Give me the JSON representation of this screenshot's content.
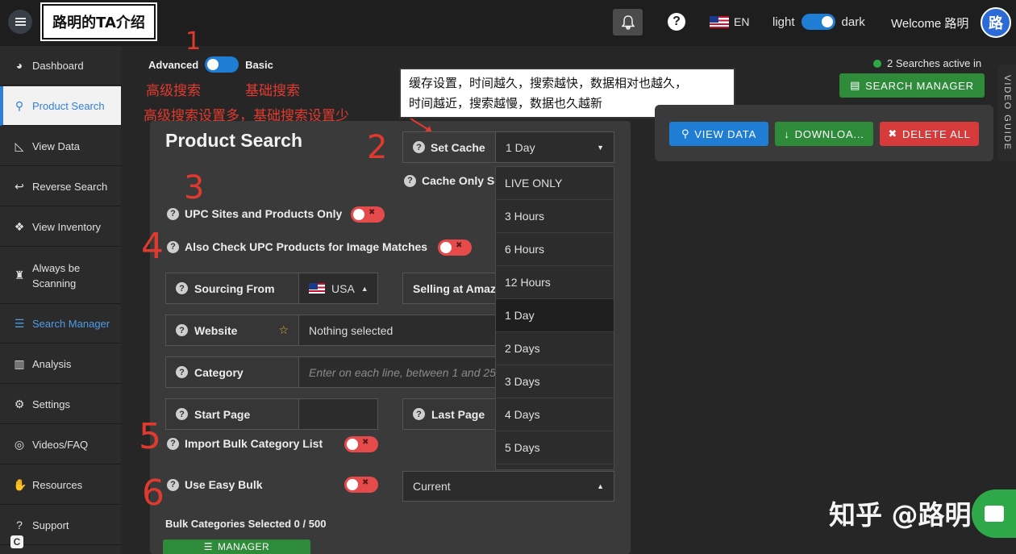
{
  "header": {
    "brand": "路明的TA介绍",
    "lang": "EN",
    "theme_light": "light",
    "theme_dark": "dark",
    "welcome": "Welcome 路明",
    "avatar_text": "路"
  },
  "sidebar": {
    "items": [
      {
        "label": "Dashboard",
        "icon": "pie-chart-icon"
      },
      {
        "label": "Product Search",
        "icon": "search-icon"
      },
      {
        "label": "View Data",
        "icon": "area-chart-icon"
      },
      {
        "label": "Reverse Search",
        "icon": "reply-icon"
      },
      {
        "label": "View Inventory",
        "icon": "cubes-icon"
      },
      {
        "label": "Always be Scanning",
        "icon": "trophy-icon"
      },
      {
        "label": "Search Manager",
        "icon": "list-alt-icon"
      },
      {
        "label": "Analysis",
        "icon": "barcode-icon"
      },
      {
        "label": "Settings",
        "icon": "gear-icon"
      },
      {
        "label": "Videos/FAQ",
        "icon": "life-ring-icon"
      },
      {
        "label": "Resources",
        "icon": "handshake-icon"
      },
      {
        "label": "Support",
        "icon": "question-icon"
      }
    ]
  },
  "mode": {
    "advanced": "Advanced",
    "basic": "Basic"
  },
  "notes": {
    "num1": "1",
    "adv_cn": "高级搜索",
    "basic_cn": "基础搜索",
    "desc_cn": "高级搜索设置多，基础搜索设置少",
    "box_line1": "缓存设置，时间越久，搜索越快，数据相对也越久，",
    "box_line2": "时间越近，搜索越慢，数据也久越新",
    "num2": "2",
    "num3": "3",
    "num4": "4",
    "num5": "5",
    "num6": "6"
  },
  "panel": {
    "title": "Product Search",
    "set_cache_label": "Set Cache",
    "set_cache_value": "1 Day",
    "cache_only_label": "Cache Only Se",
    "upc_only_label": "UPC Sites and Products Only",
    "also_check_label": "Also Check UPC Products for Image Matches",
    "sourcing_label": "Sourcing From",
    "sourcing_value": "USA",
    "selling_label": "Selling at Amaz",
    "website_label": "Website",
    "website_value": "Nothing selected",
    "category_label": "Category",
    "category_placeholder": "Enter on each line, between 1 and 25",
    "start_page_label": "Start Page",
    "last_page_label": "Last Page",
    "import_bulk_label": "Import Bulk Category List",
    "easy_bulk_label": "Use Easy Bulk",
    "current_value": "Current",
    "bulk_selected": "Bulk Categories Selected 0 / 500",
    "manager_button": "MANAGER"
  },
  "cache_options": [
    "LIVE ONLY",
    "3 Hours",
    "6 Hours",
    "12 Hours",
    "1 Day",
    "2 Days",
    "3 Days",
    "4 Days",
    "5 Days"
  ],
  "right": {
    "status": "2 Searches active in",
    "search_manager": "SEARCH MANAGER",
    "view_data": "VIEW DATA",
    "download": "DOWNLOA...",
    "delete_all": "DELETE ALL",
    "video_guide": "VIDEO GUIDE"
  },
  "watermark": "知乎 @路明",
  "colors": {
    "accent_blue": "#1f7dd4",
    "green": "#2e8b3a",
    "red": "#d63a3a",
    "annotation_red": "#e03a2f"
  }
}
